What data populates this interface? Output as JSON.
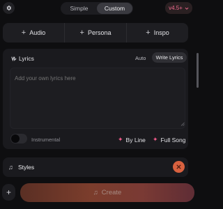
{
  "header": {
    "settings_icon": "gear-icon",
    "modes": [
      "Simple",
      "Custom"
    ],
    "active_mode": "Custom",
    "version_label": "v4.5+",
    "version_icon": "chevron-down-icon"
  },
  "add_row": {
    "items": [
      {
        "label": "Audio",
        "icon": "plus-icon"
      },
      {
        "label": "Persona",
        "icon": "plus-icon"
      },
      {
        "label": "Inspo",
        "icon": "plus-icon"
      }
    ]
  },
  "lyrics": {
    "icon": "lyrics-icon",
    "label": "Lyrics",
    "auto_label": "Auto",
    "write_label": "Write Lyrics",
    "placeholder": "Add your own lyrics here",
    "instrumental_label": "Instrumental",
    "instrumental_on": false,
    "by_line_label": "By Line",
    "full_song_label": "Full Song"
  },
  "styles": {
    "icon": "music-note-icon",
    "label": "Styles"
  },
  "footer": {
    "add_icon": "plus-icon",
    "create_label": "Create",
    "create_icon": "music-note-icon"
  },
  "colors": {
    "accent_pink": "#f25b8b",
    "styles_button": "#d8613f",
    "background": "#0e0e10"
  }
}
